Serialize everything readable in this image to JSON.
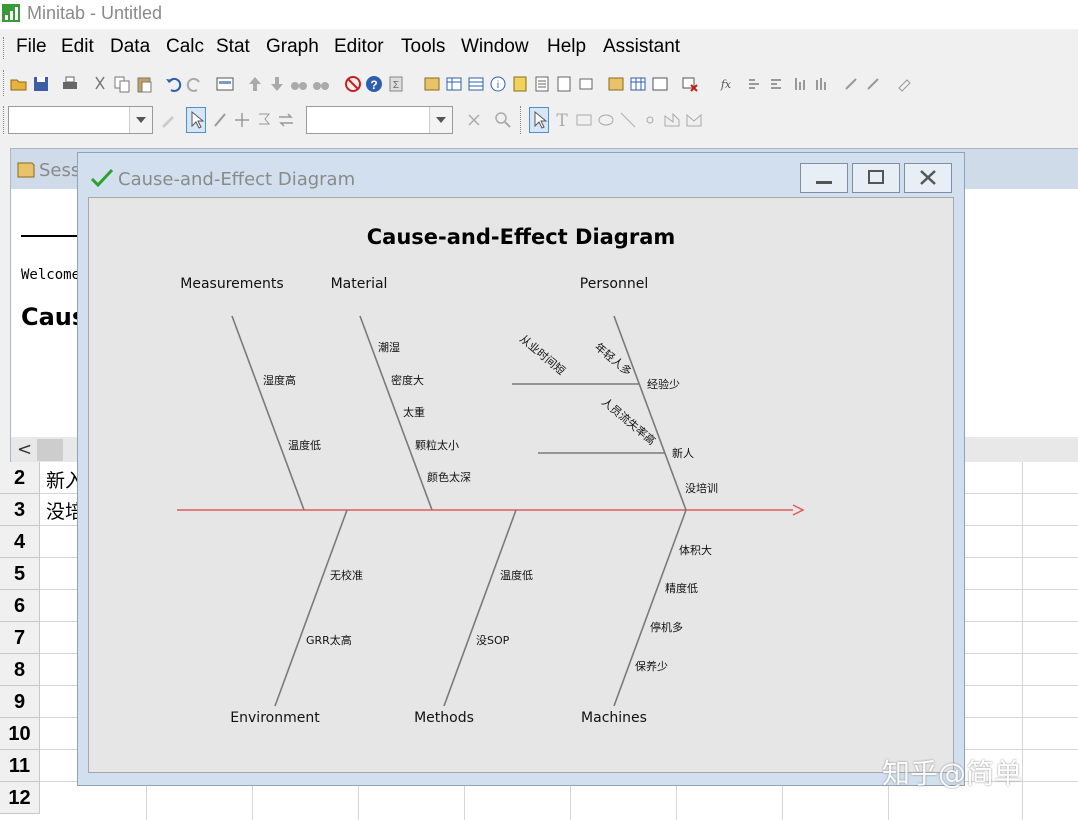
{
  "app": {
    "title": "Minitab - Untitled"
  },
  "menu": [
    "File",
    "Edit",
    "Data",
    "Calc",
    "Stat",
    "Graph",
    "Editor",
    "Tools",
    "Window",
    "Help",
    "Assistant"
  ],
  "session": {
    "title": "Sess",
    "welcome": "Welcome",
    "heading": "Caus",
    "scroll_left": "<"
  },
  "sheet": {
    "rows": [
      "2",
      "3",
      "4",
      "5",
      "6",
      "7",
      "8",
      "9",
      "10",
      "11",
      "12"
    ],
    "cells": [
      "新入",
      "没培"
    ]
  },
  "graph_window": {
    "title": "Cause-and-Effect Diagram"
  },
  "diagram": {
    "title": "Cause-and-Effect Diagram",
    "spine_color": "#e05a5a",
    "branches": {
      "measurements": {
        "label": "Measurements",
        "causes": [
          "湿度高",
          "温度低"
        ]
      },
      "material": {
        "label": "Material",
        "causes": [
          "潮湿",
          "密度大",
          "太重",
          "颗粒太小",
          "颜色太深"
        ]
      },
      "personnel": {
        "label": "Personnel",
        "causes": [
          "经验少",
          "新人",
          "没培训"
        ],
        "sub1": "从业时间短",
        "sub1_cause": "年轻人多",
        "sub2": "人员流失率高"
      },
      "environment": {
        "label": "Environment",
        "causes": [
          "无校准",
          "GRR太高"
        ]
      },
      "methods": {
        "label": "Methods",
        "causes": [
          "温度低",
          "没SOP"
        ]
      },
      "machines": {
        "label": "Machines",
        "causes": [
          "体积大",
          "精度低",
          "停机多",
          "保养少"
        ]
      }
    }
  },
  "watermark": "知乎@简单"
}
